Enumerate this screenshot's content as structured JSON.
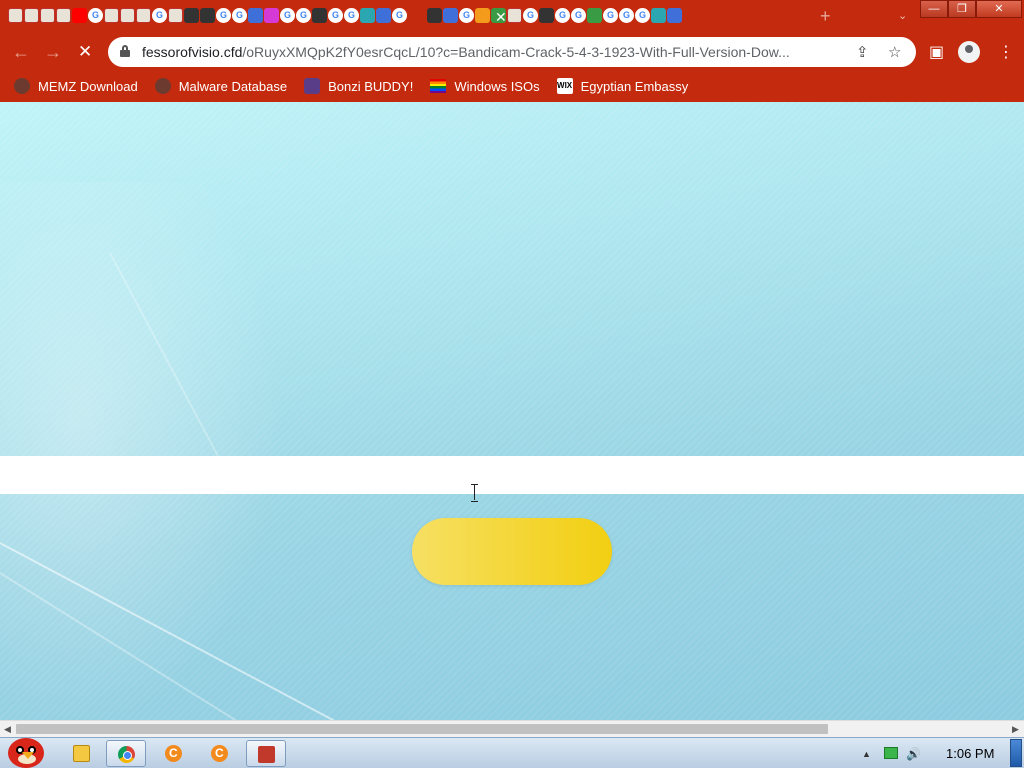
{
  "browser": {
    "tabs_favicons": [
      "house",
      "house",
      "house",
      "house",
      "youtube",
      "google",
      "house",
      "house",
      "house",
      "google",
      "house",
      "vpn",
      "wix",
      "google",
      "google",
      "blue",
      "pink",
      "google",
      "google",
      "cursor",
      "google",
      "google",
      "shield",
      "blue",
      "google",
      "active-close",
      "pages",
      "blue",
      "google",
      "ccleaner",
      "ms",
      "doc",
      "google",
      "w",
      "google",
      "google",
      "green",
      "google",
      "google",
      "google",
      "circle",
      "blue"
    ],
    "active_tab_close": "✕",
    "new_tab": "+",
    "tab_list": "⌄",
    "window_buttons": {
      "minimize": "—",
      "maximize": "❐",
      "close": "✕"
    },
    "nav": {
      "back": "←",
      "forward": "→",
      "stop": "✕"
    },
    "url_host": "fessorofvisio.cfd",
    "url_rest": "/oRuyxXMQpK2fY0esrCqcL/10?c=Bandicam-Crack-5-4-3-1923-With-Full-Version-Dow...",
    "share_icon": "⇪",
    "star_icon": "☆",
    "side_panel_icon": "▣",
    "menu_icon": "⋮"
  },
  "bookmarks": [
    {
      "label": "MEMZ Download",
      "icon": "globe"
    },
    {
      "label": "Malware Database",
      "icon": "globe"
    },
    {
      "label": "Bonzi BUDDY!",
      "icon": "bonzi"
    },
    {
      "label": "Windows ISOs",
      "icon": "rainbow"
    },
    {
      "label": "Egyptian Embassy",
      "icon": "wix"
    }
  ],
  "bookmark_wix_text": "WIX",
  "page": {
    "cta_label": "",
    "colors": {
      "button": "#f4d530",
      "bar": "#ffffff",
      "background": "#aee6ef"
    }
  },
  "scrollbar": {
    "left": "◀",
    "right": "▶"
  },
  "taskbar": {
    "clock": "1:06 PM",
    "tray_up": "▲",
    "volume_icon": "🔊"
  }
}
